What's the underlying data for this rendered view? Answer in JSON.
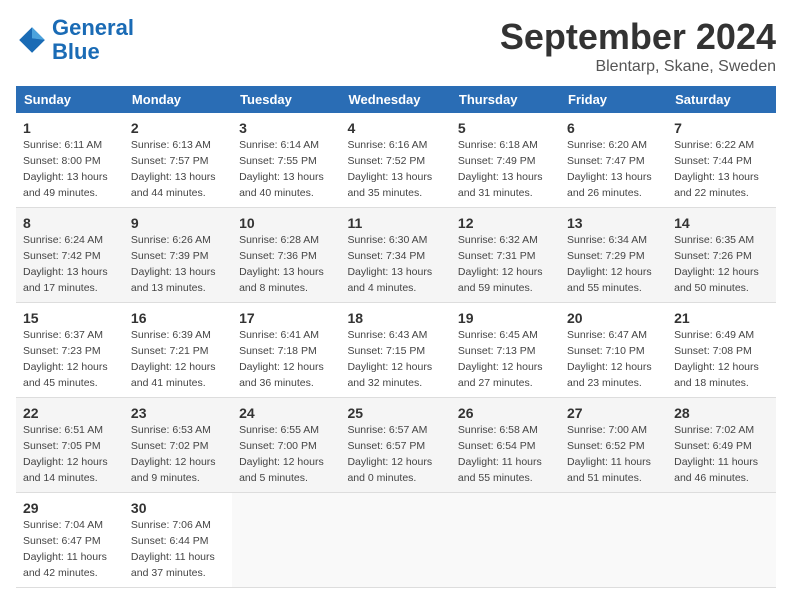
{
  "header": {
    "logo_general": "General",
    "logo_blue": "Blue",
    "month": "September 2024",
    "location": "Blentarp, Skane, Sweden"
  },
  "days_of_week": [
    "Sunday",
    "Monday",
    "Tuesday",
    "Wednesday",
    "Thursday",
    "Friday",
    "Saturday"
  ],
  "weeks": [
    [
      {
        "day": "1",
        "sunrise": "6:11 AM",
        "sunset": "8:00 PM",
        "daylight": "13 hours and 49 minutes."
      },
      {
        "day": "2",
        "sunrise": "6:13 AM",
        "sunset": "7:57 PM",
        "daylight": "13 hours and 44 minutes."
      },
      {
        "day": "3",
        "sunrise": "6:14 AM",
        "sunset": "7:55 PM",
        "daylight": "13 hours and 40 minutes."
      },
      {
        "day": "4",
        "sunrise": "6:16 AM",
        "sunset": "7:52 PM",
        "daylight": "13 hours and 35 minutes."
      },
      {
        "day": "5",
        "sunrise": "6:18 AM",
        "sunset": "7:49 PM",
        "daylight": "13 hours and 31 minutes."
      },
      {
        "day": "6",
        "sunrise": "6:20 AM",
        "sunset": "7:47 PM",
        "daylight": "13 hours and 26 minutes."
      },
      {
        "day": "7",
        "sunrise": "6:22 AM",
        "sunset": "7:44 PM",
        "daylight": "13 hours and 22 minutes."
      }
    ],
    [
      {
        "day": "8",
        "sunrise": "6:24 AM",
        "sunset": "7:42 PM",
        "daylight": "13 hours and 17 minutes."
      },
      {
        "day": "9",
        "sunrise": "6:26 AM",
        "sunset": "7:39 PM",
        "daylight": "13 hours and 13 minutes."
      },
      {
        "day": "10",
        "sunrise": "6:28 AM",
        "sunset": "7:36 PM",
        "daylight": "13 hours and 8 minutes."
      },
      {
        "day": "11",
        "sunrise": "6:30 AM",
        "sunset": "7:34 PM",
        "daylight": "13 hours and 4 minutes."
      },
      {
        "day": "12",
        "sunrise": "6:32 AM",
        "sunset": "7:31 PM",
        "daylight": "12 hours and 59 minutes."
      },
      {
        "day": "13",
        "sunrise": "6:34 AM",
        "sunset": "7:29 PM",
        "daylight": "12 hours and 55 minutes."
      },
      {
        "day": "14",
        "sunrise": "6:35 AM",
        "sunset": "7:26 PM",
        "daylight": "12 hours and 50 minutes."
      }
    ],
    [
      {
        "day": "15",
        "sunrise": "6:37 AM",
        "sunset": "7:23 PM",
        "daylight": "12 hours and 45 minutes."
      },
      {
        "day": "16",
        "sunrise": "6:39 AM",
        "sunset": "7:21 PM",
        "daylight": "12 hours and 41 minutes."
      },
      {
        "day": "17",
        "sunrise": "6:41 AM",
        "sunset": "7:18 PM",
        "daylight": "12 hours and 36 minutes."
      },
      {
        "day": "18",
        "sunrise": "6:43 AM",
        "sunset": "7:15 PM",
        "daylight": "12 hours and 32 minutes."
      },
      {
        "day": "19",
        "sunrise": "6:45 AM",
        "sunset": "7:13 PM",
        "daylight": "12 hours and 27 minutes."
      },
      {
        "day": "20",
        "sunrise": "6:47 AM",
        "sunset": "7:10 PM",
        "daylight": "12 hours and 23 minutes."
      },
      {
        "day": "21",
        "sunrise": "6:49 AM",
        "sunset": "7:08 PM",
        "daylight": "12 hours and 18 minutes."
      }
    ],
    [
      {
        "day": "22",
        "sunrise": "6:51 AM",
        "sunset": "7:05 PM",
        "daylight": "12 hours and 14 minutes."
      },
      {
        "day": "23",
        "sunrise": "6:53 AM",
        "sunset": "7:02 PM",
        "daylight": "12 hours and 9 minutes."
      },
      {
        "day": "24",
        "sunrise": "6:55 AM",
        "sunset": "7:00 PM",
        "daylight": "12 hours and 5 minutes."
      },
      {
        "day": "25",
        "sunrise": "6:57 AM",
        "sunset": "6:57 PM",
        "daylight": "12 hours and 0 minutes."
      },
      {
        "day": "26",
        "sunrise": "6:58 AM",
        "sunset": "6:54 PM",
        "daylight": "11 hours and 55 minutes."
      },
      {
        "day": "27",
        "sunrise": "7:00 AM",
        "sunset": "6:52 PM",
        "daylight": "11 hours and 51 minutes."
      },
      {
        "day": "28",
        "sunrise": "7:02 AM",
        "sunset": "6:49 PM",
        "daylight": "11 hours and 46 minutes."
      }
    ],
    [
      {
        "day": "29",
        "sunrise": "7:04 AM",
        "sunset": "6:47 PM",
        "daylight": "11 hours and 42 minutes."
      },
      {
        "day": "30",
        "sunrise": "7:06 AM",
        "sunset": "6:44 PM",
        "daylight": "11 hours and 37 minutes."
      },
      null,
      null,
      null,
      null,
      null
    ]
  ]
}
